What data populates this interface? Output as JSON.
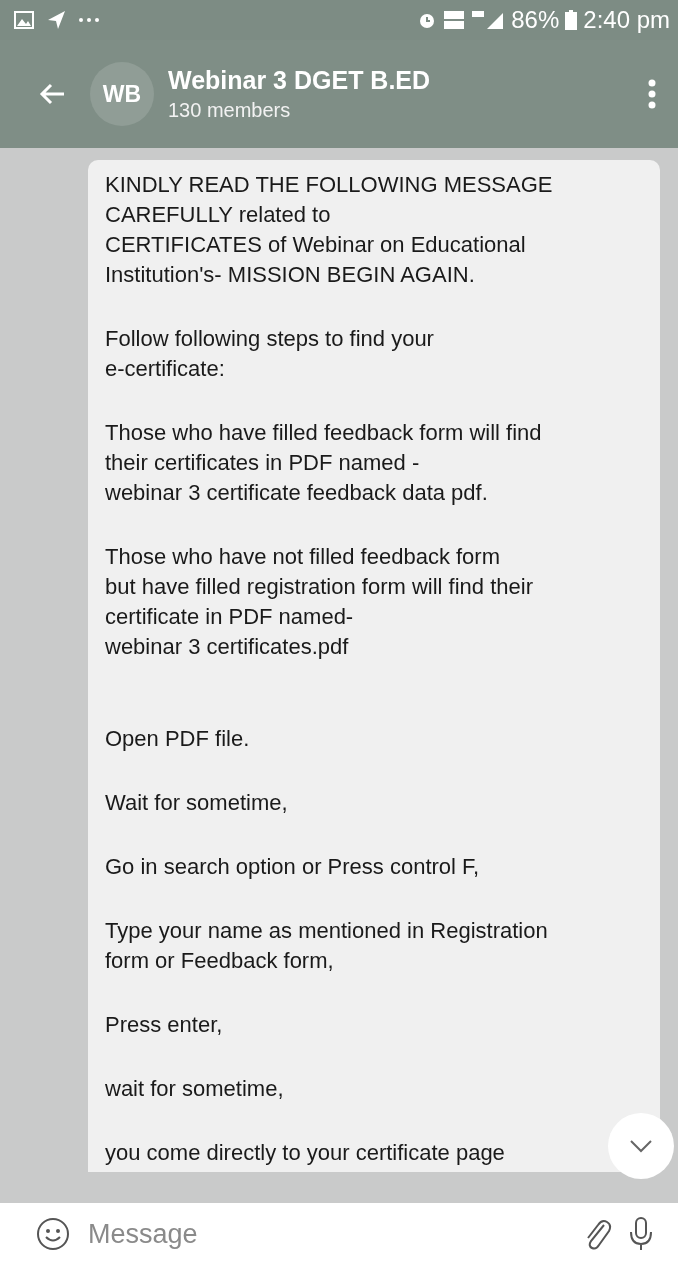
{
  "status_bar": {
    "battery": "86%",
    "time": "2:40 pm"
  },
  "header": {
    "avatar_initials": "WB",
    "title": "Webinar 3 DGET B.ED",
    "subtitle": "130 members"
  },
  "message": {
    "paragraphs": [
      "KINDLY READ THE FOLLOWING MESSAGE\nCAREFULLY related to\nCERTIFICATES of Webinar on Educational\nInstitution's- MISSION BEGIN AGAIN.",
      "Follow following steps to find your\ne-certificate:",
      "Those who have filled feedback form will find\ntheir certificates in PDF named -\nwebinar 3 certificate feedback data pdf.",
      "Those who have not filled feedback form\nbut have filled registration form will find their\ncertificate in PDF named-\nwebinar 3 certificates.pdf",
      "Open PDF file.",
      "Wait for sometime,",
      "Go in search option or Press control F,",
      "Type your name as mentioned in Registration\nform or Feedback form,",
      "Press enter,",
      "wait for sometime,",
      "you come directly to your certificate page"
    ]
  },
  "composer": {
    "placeholder": "Message"
  }
}
